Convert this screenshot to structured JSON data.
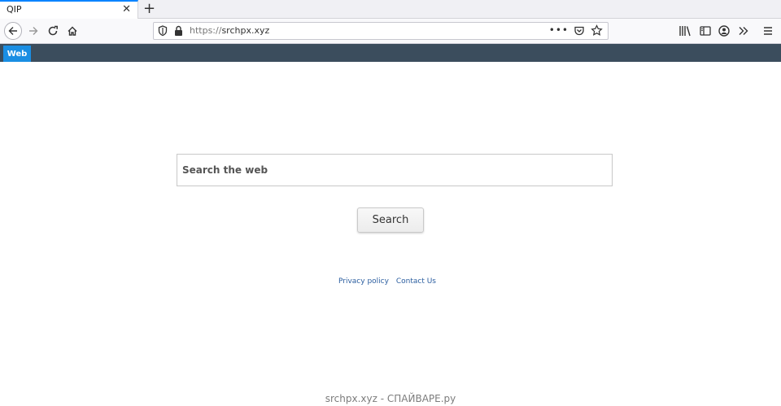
{
  "browser": {
    "tab_title": "QIP",
    "tab_close": "✕",
    "new_tab": "+",
    "url_prefix": "https://",
    "url_host": "srchpx.xyz",
    "url_more": "•••"
  },
  "site": {
    "web_tab": "Web",
    "search_placeholder": "Search the web",
    "search_button": "Search",
    "privacy_link": "Privacy policy",
    "contact_link": "Contact Us"
  },
  "watermark": "srchpx.xyz - СПАЙВАРЕ.ру",
  "colors": {
    "header_bg": "#3b4d5d",
    "web_tab_bg": "#1a8ee3",
    "link": "#2a5d9f"
  }
}
